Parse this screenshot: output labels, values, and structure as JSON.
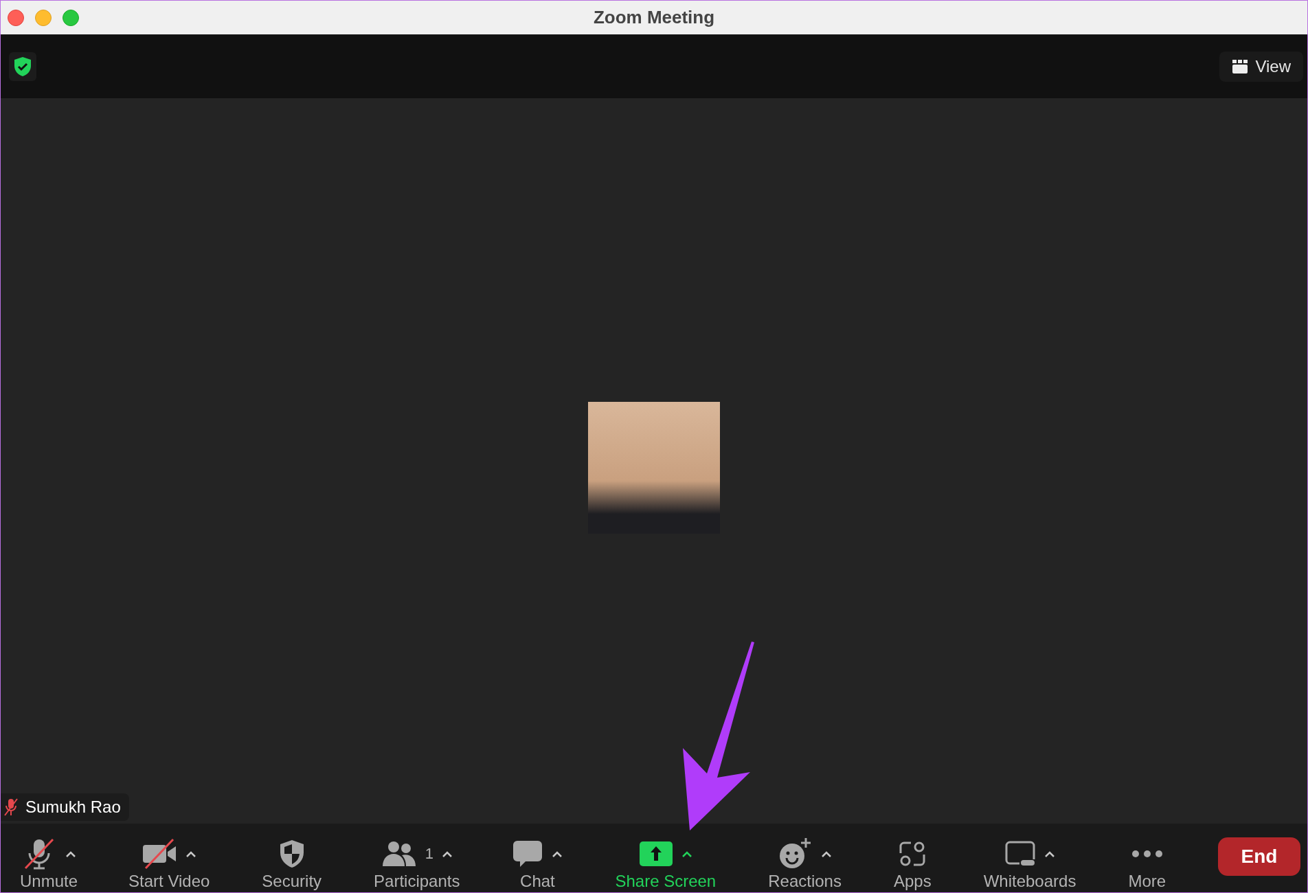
{
  "window": {
    "title": "Zoom Meeting"
  },
  "top_bar": {
    "view_button": "View"
  },
  "participant": {
    "name": "Sumukh Rao",
    "muted": true
  },
  "toolbar": [
    {
      "kind": "audio",
      "label": "Unmute",
      "has_caret": true,
      "highlighted": false,
      "crossed": true
    },
    {
      "kind": "video",
      "label": "Start Video",
      "has_caret": true,
      "highlighted": false,
      "crossed": true
    },
    {
      "kind": "security",
      "label": "Security",
      "has_caret": false,
      "highlighted": false,
      "crossed": false
    },
    {
      "kind": "participants",
      "label": "Participants",
      "count": "1",
      "has_caret": true,
      "highlighted": false,
      "crossed": false
    },
    {
      "kind": "chat",
      "label": "Chat",
      "has_caret": true,
      "highlighted": false,
      "crossed": false
    },
    {
      "kind": "share",
      "label": "Share Screen",
      "has_caret": true,
      "highlighted": true,
      "crossed": false
    },
    {
      "kind": "reactions",
      "label": "Reactions",
      "has_caret": true,
      "highlighted": false,
      "crossed": false
    },
    {
      "kind": "apps",
      "label": "Apps",
      "has_caret": false,
      "highlighted": false,
      "crossed": false
    },
    {
      "kind": "whiteboards",
      "label": "Whiteboards",
      "has_caret": true,
      "highlighted": false,
      "crossed": false
    },
    {
      "kind": "more",
      "label": "More",
      "has_caret": false,
      "highlighted": false,
      "crossed": false
    }
  ],
  "end_button": "End"
}
